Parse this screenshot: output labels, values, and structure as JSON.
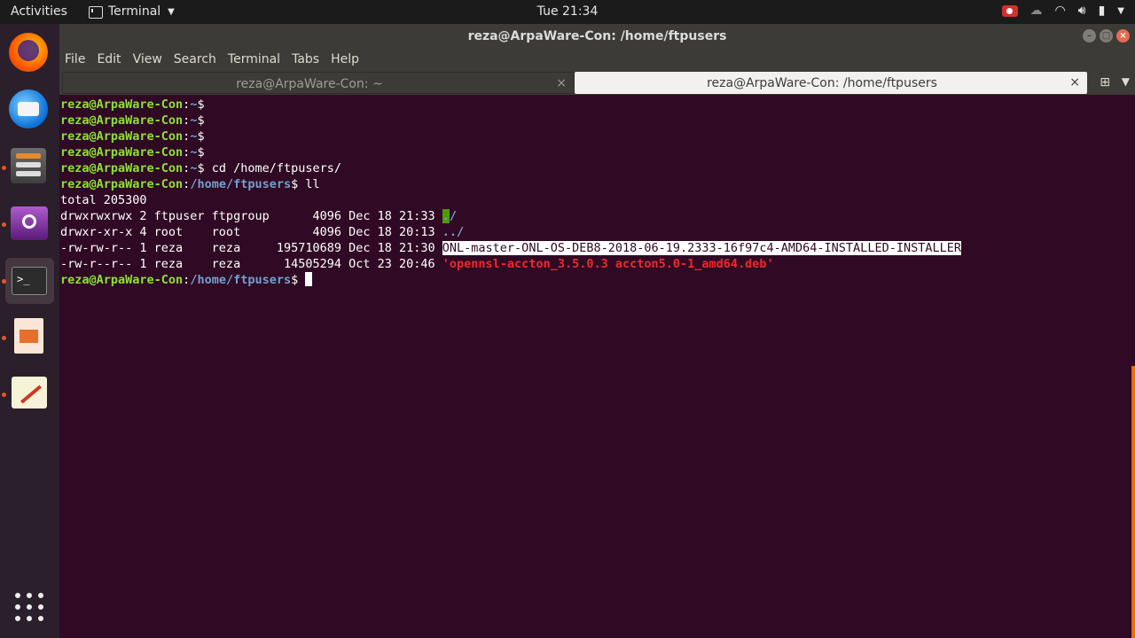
{
  "topbar": {
    "activities": "Activities",
    "app_name": "Terminal",
    "clock": "Tue 21:34"
  },
  "window": {
    "title": "reza@ArpaWare-Con: /home/ftpusers"
  },
  "menu": [
    "File",
    "Edit",
    "View",
    "Search",
    "Terminal",
    "Tabs",
    "Help"
  ],
  "tabs": [
    {
      "label": "reza@ArpaWare-Con: ~",
      "close": "×"
    },
    {
      "label": "reza@ArpaWare-Con: /home/ftpusers",
      "close": "×"
    }
  ],
  "terminal": {
    "prompt_user": "reza@ArpaWare-Con",
    "lines": {
      "l1": {
        "user": "reza@ArpaWare-Con",
        "sep": ":",
        "path": "~",
        "rest": "$"
      },
      "l2": {
        "user": "reza@ArpaWare-Con",
        "sep": ":",
        "path": "~",
        "rest": "$"
      },
      "l3": {
        "user": "reza@ArpaWare-Con",
        "sep": ":",
        "path": "~",
        "rest": "$"
      },
      "l4": {
        "user": "reza@ArpaWare-Con",
        "sep": ":",
        "path": "~",
        "rest": "$"
      },
      "l5": {
        "user": "reza@ArpaWare-Con",
        "sep": ":",
        "path": "~",
        "rest": "$ cd /home/ftpusers/"
      },
      "l6": {
        "user": "reza@ArpaWare-Con",
        "sep": ":",
        "path": "/home/ftpusers",
        "rest": "$ ll"
      },
      "l7": "total 205300",
      "l8": {
        "meta": "drwxrwxrwx 2 ftpuser ftpgroup      4096 Dec 18 21:33 ",
        "name_a": ".",
        "name_b": "/"
      },
      "l9": {
        "meta": "drwxr-xr-x 4 root    root          4096 Dec 18 20:13 ",
        "name": "../"
      },
      "l10": {
        "meta": "-rw-rw-r-- 1 reza    reza     195710689 Dec 18 21:30 ",
        "name": "ONL-master-ONL-OS-DEB8-2018-06-19.2333-16f97c4-AMD64-INSTALLED-INSTALLER"
      },
      "l11": {
        "meta": "-rw-r--r-- 1 reza    reza      14505294 Oct 23 20:46 ",
        "name": "'opennsl-accton_3.5.0.3 accton5.0-1_amd64.deb'"
      },
      "l12": {
        "user": "reza@ArpaWare-Con",
        "sep": ":",
        "path": "/home/ftpusers",
        "rest": "$ "
      }
    }
  },
  "colors": {
    "terminal_bg": "#300a24",
    "prompt_user": "#8ae234",
    "prompt_path": "#729fcf",
    "deb_file": "#ef2929",
    "accent": "#e95420"
  },
  "icons": {
    "launcher": [
      "firefox-icon",
      "thunderbird-icon",
      "files-icon",
      "video-icon",
      "terminal-icon",
      "impress-icon",
      "text-editor-icon",
      "show-apps-icon"
    ]
  }
}
